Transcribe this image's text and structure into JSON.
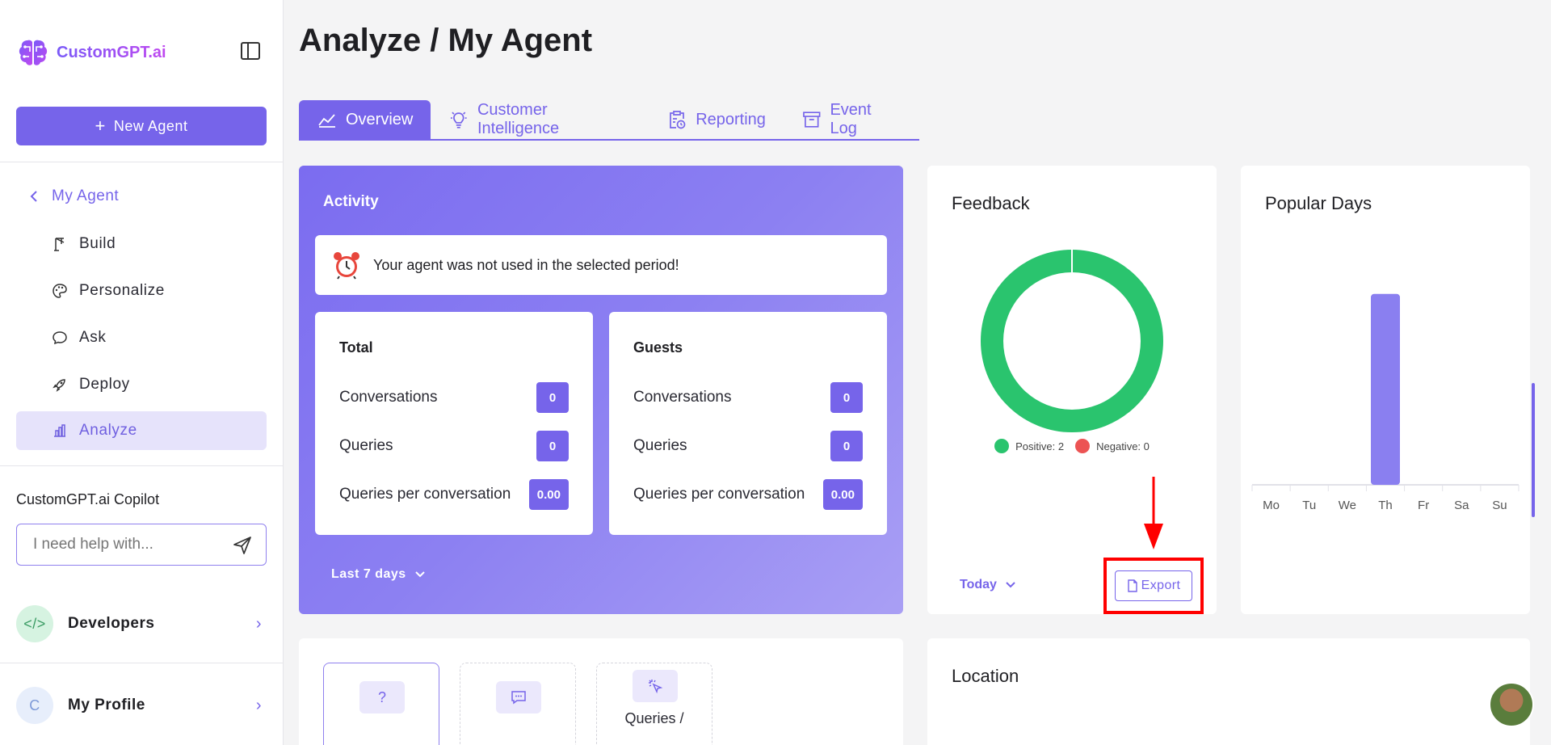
{
  "app": {
    "logo_text": "CustomGPT.ai"
  },
  "sidebar": {
    "new_agent_label": "New Agent",
    "back_label": "My Agent",
    "items": [
      {
        "label": "Build",
        "icon": "crane-icon",
        "active": false
      },
      {
        "label": "Personalize",
        "icon": "palette-icon",
        "active": false
      },
      {
        "label": "Ask",
        "icon": "chat-bubble-icon",
        "active": false
      },
      {
        "label": "Deploy",
        "icon": "rocket-icon",
        "active": false
      },
      {
        "label": "Analyze",
        "icon": "bar-chart-icon",
        "active": true
      }
    ],
    "copilot": {
      "title": "CustomGPT.ai Copilot",
      "placeholder": "I need help with..."
    },
    "developers_label": "Developers",
    "profile": {
      "label": "My Profile",
      "initial": "C"
    }
  },
  "header": {
    "title": "Analyze / My Agent"
  },
  "tabs": [
    {
      "label": "Overview",
      "icon": "line-chart-icon",
      "active": true
    },
    {
      "label": "Customer Intelligence",
      "icon": "lightbulb-icon",
      "active": false
    },
    {
      "label": "Reporting",
      "icon": "clipboard-clock-icon",
      "active": false
    },
    {
      "label": "Event Log",
      "icon": "archive-icon",
      "active": false
    }
  ],
  "activity": {
    "title": "Activity",
    "notice": "Your agent was not used in the selected period!",
    "total": {
      "title": "Total",
      "rows": [
        {
          "label": "Conversations",
          "value": "0"
        },
        {
          "label": "Queries",
          "value": "0"
        },
        {
          "label": "Queries per conversation",
          "value": "0.00"
        }
      ]
    },
    "guests": {
      "title": "Guests",
      "rows": [
        {
          "label": "Conversations",
          "value": "0"
        },
        {
          "label": "Queries",
          "value": "0"
        },
        {
          "label": "Queries per conversation",
          "value": "0.00"
        }
      ]
    },
    "range_label": "Last 7 days"
  },
  "feedback": {
    "title": "Feedback",
    "positive_label": "Positive: 2",
    "negative_label": "Negative: 0",
    "positive_color": "#2ac46e",
    "negative_color": "#ec5353",
    "range_label": "Today",
    "export_label": "Export"
  },
  "popular_days": {
    "title": "Popular Days",
    "bar_color": "#8a7ff0"
  },
  "chart_data": [
    {
      "type": "pie",
      "categories": [
        "Positive",
        "Negative"
      ],
      "values": [
        2,
        0
      ],
      "title": "Feedback",
      "legend": "bottom"
    },
    {
      "type": "bar",
      "categories": [
        "Mo",
        "Tu",
        "We",
        "Th",
        "Fr",
        "Sa",
        "Su"
      ],
      "values": [
        0,
        0,
        0,
        1,
        0,
        0,
        0
      ],
      "title": "Popular Days",
      "ylim": [
        0,
        1.27
      ],
      "grid": false
    }
  ],
  "location": {
    "title": "Location"
  },
  "bottom_tiles": [
    {
      "icon": "question-icon",
      "glyph": "?",
      "label": ""
    },
    {
      "icon": "message-icon",
      "glyph": "",
      "label": ""
    },
    {
      "icon": "cursor-click-icon",
      "glyph": "",
      "label": "Queries /"
    }
  ]
}
